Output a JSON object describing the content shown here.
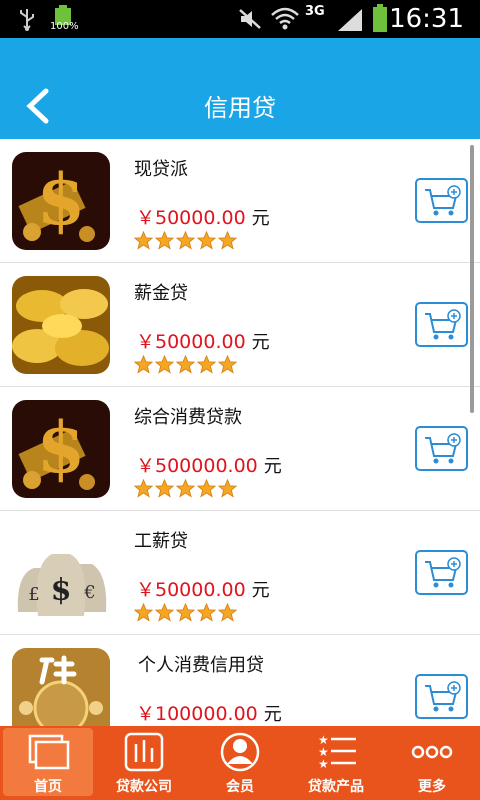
{
  "status_bar": {
    "battery_percent": "100%",
    "network": "3G",
    "time": "16:31"
  },
  "header": {
    "title": "信用贷"
  },
  "products": [
    {
      "name": "现贷派",
      "price": "￥50000.00",
      "unit": "元",
      "rating": 5,
      "image": "gold-dollar-sign"
    },
    {
      "name": "薪金贷",
      "price": "￥50000.00",
      "unit": "元",
      "rating": 5,
      "image": "gold-ingots"
    },
    {
      "name": "综合消费贷款",
      "price": "￥500000.00",
      "unit": "元",
      "rating": 5,
      "image": "gold-dollar-sign"
    },
    {
      "name": "工薪贷",
      "price": "￥50000.00",
      "unit": "元",
      "rating": 5,
      "image": "money-bags"
    },
    {
      "name": "个人消费信用贷",
      "price": "￥100000.00",
      "unit": "元",
      "rating": 5,
      "image": "loan-logo"
    }
  ],
  "tabs": [
    {
      "label": "首页",
      "icon": "home-icon",
      "active": true
    },
    {
      "label": "贷款公司",
      "icon": "chart-icon",
      "active": false
    },
    {
      "label": "会员",
      "icon": "user-icon",
      "active": false
    },
    {
      "label": "贷款产品",
      "icon": "list-icon",
      "active": false
    },
    {
      "label": "更多",
      "icon": "more-icon",
      "active": false
    }
  ],
  "colors": {
    "header": "#1aa6e6",
    "tabbar": "#e9541c",
    "price": "#e0141e",
    "cart_border": "#2a8dd6",
    "star": "#f5a623"
  }
}
